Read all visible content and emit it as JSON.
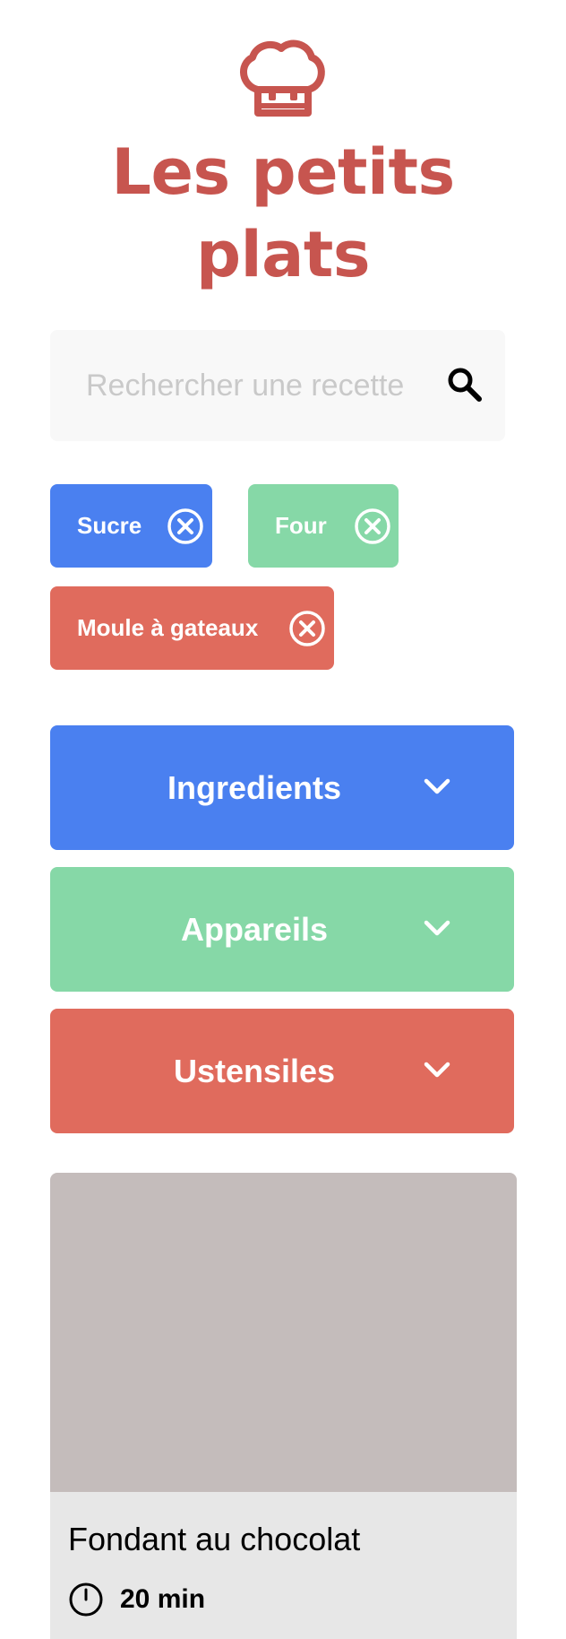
{
  "header": {
    "logo_icon": "chef-hat-icon",
    "title_line1": "Les petits",
    "title_line2": "plats"
  },
  "search": {
    "placeholder": "Rechercher une recette",
    "value": "",
    "icon": "search-icon"
  },
  "selected_tags": [
    {
      "label": "Sucre",
      "type": "ingredient",
      "color": "#4a80f0"
    },
    {
      "label": "Four",
      "type": "appareil",
      "color": "#86d8a7"
    },
    {
      "label": "Moule à gateaux",
      "type": "ustensile",
      "color": "#e06b5d"
    }
  ],
  "filters": [
    {
      "label": "Ingredients",
      "color": "#4a80f0",
      "icon": "chevron-down-icon"
    },
    {
      "label": "Appareils",
      "color": "#86d8a7",
      "icon": "chevron-down-icon"
    },
    {
      "label": "Ustensiles",
      "color": "#e06b5d",
      "icon": "chevron-down-icon"
    }
  ],
  "recipes": [
    {
      "title": "Fondant au chocolat",
      "time": "20 min",
      "time_icon": "clock-icon"
    }
  ],
  "colors": {
    "brand": "#c7554f",
    "blue": "#4a80f0",
    "green": "#86d8a7",
    "red": "#e06b5d",
    "card_image": "#c4bcbb",
    "card_body": "#e7e7e7"
  }
}
